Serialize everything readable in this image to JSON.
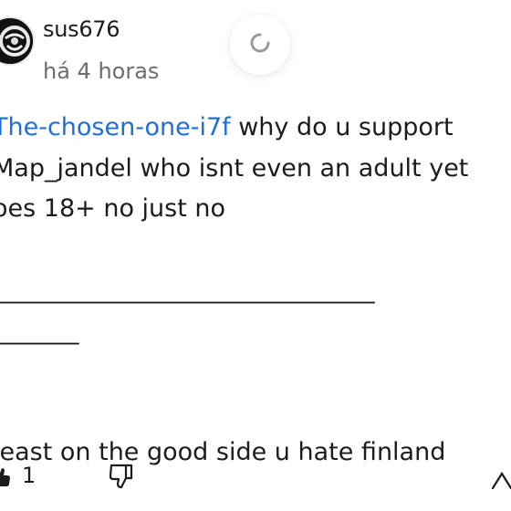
{
  "comment": {
    "username": "sus676",
    "timestamp": "há 4 horas",
    "mention": "The-chosen-one-i7f",
    "lines": [
      " why do u support",
      "Map_jandel who isnt even an adult yet",
      "oes 18+ no just no",
      "",
      "_______________________________",
      "_______",
      "",
      "",
      "least on the good side u hate finland"
    ],
    "like_count": "1"
  },
  "icons": {
    "refresh": "refresh-icon",
    "like": "thumbs-up-icon",
    "dislike": "thumbs-down-icon",
    "more": "more-icon"
  }
}
